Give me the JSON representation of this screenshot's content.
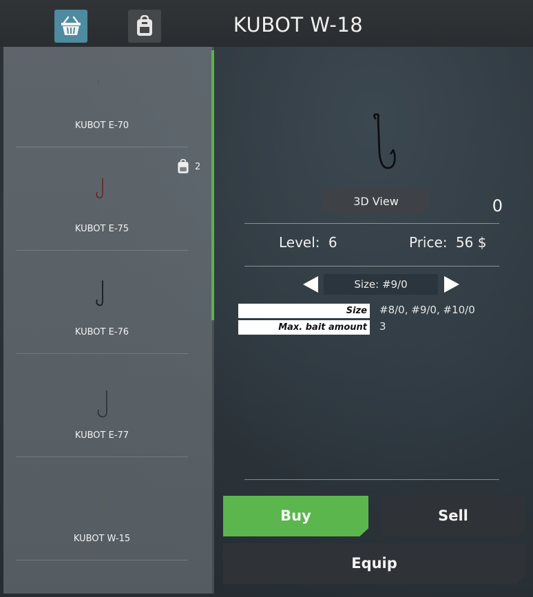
{
  "header": {
    "title": "KUBOT W-18",
    "tab_shop_icon": "basket-icon",
    "tab_inventory_icon": "backpack-icon"
  },
  "list": {
    "items": [
      {
        "label": "KUBOT E-70",
        "owned_count": ""
      },
      {
        "label": "KUBOT E-75",
        "owned_count": "2"
      },
      {
        "label": "KUBOT E-76",
        "owned_count": ""
      },
      {
        "label": "KUBOT E-77",
        "owned_count": ""
      },
      {
        "label": "KUBOT W-15",
        "owned_count": ""
      }
    ]
  },
  "detail": {
    "view3d_label": "3D View",
    "quantity": "0",
    "level_label": "Level:",
    "level_value": "6",
    "price_label": "Price:",
    "price_value": "56 $",
    "size_selector": "Size: #9/0",
    "properties": [
      {
        "name": "Size",
        "value": "#8/0, #9/0, #10/0"
      },
      {
        "name": "Max. bait amount",
        "value": "3"
      }
    ]
  },
  "actions": {
    "buy": "Buy",
    "sell": "Sell",
    "equip": "Equip"
  },
  "colors": {
    "accent_green": "#5bb64d",
    "tab_active": "#4e8aa0"
  }
}
